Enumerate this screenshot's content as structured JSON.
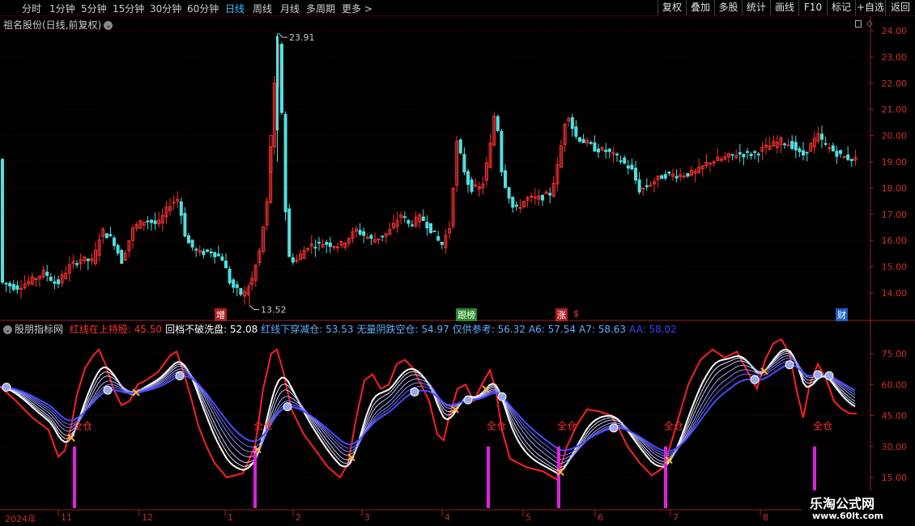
{
  "toolbar": {
    "timeframes": [
      "分时",
      "1分钟",
      "5分钟",
      "15分钟",
      "30分钟",
      "60分钟",
      "日线",
      "周线",
      "月线",
      "多周期",
      "更多 >"
    ],
    "active_index": 6,
    "right_buttons": [
      "复权",
      "叠加",
      "多股",
      "统计",
      "画线",
      "F10",
      "标记",
      "+自选",
      "返回"
    ]
  },
  "main_chart": {
    "stock_title": "祖名股份(日线,前复权)",
    "high_label": "23.91",
    "low_label": "13.52",
    "price_axis": [
      "24.00",
      "23.00",
      "22.00",
      "21.00",
      "20.00",
      "19.00",
      "18.00",
      "17.00",
      "16.00",
      "15.00",
      "14.00"
    ],
    "annotations": [
      {
        "text": "增",
        "bg": "#b02020"
      },
      {
        "text": "跟榜",
        "bg": "#2a8a2a"
      },
      {
        "text": "涨",
        "bg": "#b02020"
      },
      {
        "text": "$",
        "bg": "#000000"
      },
      {
        "text": "财",
        "bg": "#2060c0"
      }
    ]
  },
  "indicator": {
    "name": "股朋指标网",
    "items": [
      {
        "label": "红线在上持股: ",
        "value": "45.50",
        "color": "#ff3030"
      },
      {
        "label": "回档不破洗盘: ",
        "value": "52.08",
        "color": "#ffffff"
      },
      {
        "label": "红线下穿减仓: ",
        "value": "53.53",
        "color": "#60b0ff"
      },
      {
        "label": "无量阴跌空仓: ",
        "value": "54.97",
        "color": "#60b0ff"
      },
      {
        "label": "仅供参考: ",
        "value": "56.32",
        "color": "#60b0ff"
      },
      {
        "label": "A6: ",
        "value": "57.54",
        "color": "#60b0ff"
      },
      {
        "label": "A7: ",
        "value": "58.63",
        "color": "#60b0ff"
      },
      {
        "label": "AA: ",
        "value": "58.02",
        "color": "#4040ff"
      }
    ],
    "axis": [
      "75.00",
      "60.00",
      "45.00",
      "30.00",
      "15.00"
    ],
    "signal_label": "全仓"
  },
  "dates": [
    "2024年",
    "11",
    "12",
    "1",
    "2",
    "3",
    "4",
    "5",
    "6",
    "7",
    "8"
  ],
  "watermark": {
    "line1": "乐淘公式网",
    "line2": "www.60lt.com"
  },
  "colors": {
    "up": "#ff3030",
    "down": "#50e0e0",
    "grid": "#3a0000",
    "signal": "#e020e0"
  }
}
